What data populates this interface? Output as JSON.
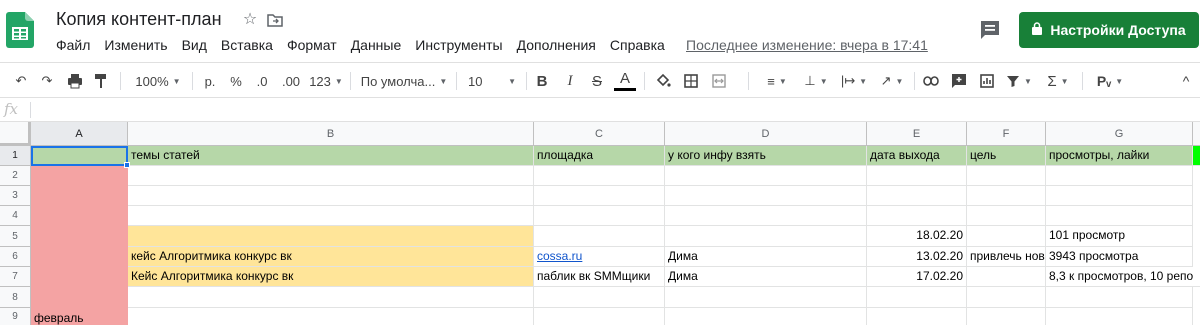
{
  "header": {
    "title": "Копия контент-план",
    "last_edit": "Последнее изменение: вчера в 17:41",
    "share_label": "Настройки Доступа",
    "menu": [
      "Файл",
      "Изменить",
      "Вид",
      "Вставка",
      "Формат",
      "Данные",
      "Инструменты",
      "Дополнения",
      "Справка"
    ],
    "brand_color": "#188038"
  },
  "toolbar": {
    "zoom": "100%",
    "currency": "р.",
    "percent": "%",
    "dec_less": ".0",
    "dec_more": ".00",
    "number_format": "123",
    "font": "По умолча...",
    "font_size": "10",
    "bold": "B",
    "italic": "I",
    "strike": "S",
    "text_color": "A",
    "input_tools": "Рᵥ"
  },
  "formula": {
    "fx": "fx",
    "value": ""
  },
  "columns": [
    "A",
    "B",
    "C",
    "D",
    "E",
    "F",
    "G"
  ],
  "rows": [
    "1",
    "2",
    "3",
    "4",
    "5",
    "6",
    "7",
    "8",
    "9"
  ],
  "cells": {
    "B1": "темы статей",
    "C1": "площадка",
    "D1": "у кого инфу взять",
    "E1": "дата выхода",
    "F1": "цель",
    "G1": "просмотры, лайки",
    "E5": "18.02.20",
    "G5": "101 просмотр",
    "B6": "кейс Алгоритмика конкурс вк",
    "C6": "cossa.ru",
    "D6": "Дима",
    "E6": "13.02.20",
    "F6": "привлечь нов",
    "G6": "3943 просмотра",
    "B7": "Кейс Алгоритмика конкурс вк",
    "C7": "паблик вк SMMщики",
    "D7": "Дима",
    "E7": "17.02.20",
    "G7": "8,3 к просмотров, 10 репо",
    "A9": "февраль"
  },
  "colors": {
    "header_row": "#b6d7a8",
    "highlight": "#ffe599",
    "month": "#f4a3a3",
    "selection": "#1a73e8"
  }
}
